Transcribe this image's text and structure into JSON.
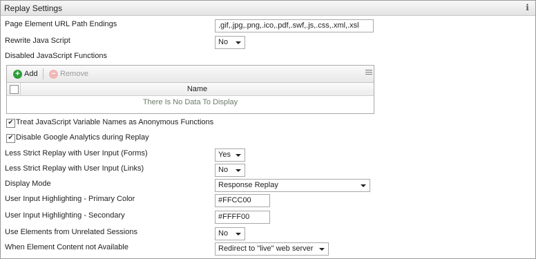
{
  "panel": {
    "title": "Replay Settings",
    "info_icon": "info-icon"
  },
  "fields": {
    "url_endings": {
      "label": "Page Element URL Path Endings",
      "value": ".gif,.jpg,.png,.ico,.pdf,.swf,.js,.css,.xml,.xsl"
    },
    "rewrite_js": {
      "label": "Rewrite Java Script",
      "value": "No"
    },
    "disabled_js": {
      "label": "Disabled JavaScript Functions"
    },
    "less_strict_forms": {
      "label": "Less Strict Replay with User Input (Forms)",
      "value": "Yes"
    },
    "less_strict_links": {
      "label": "Less Strict Replay with User Input (Links)",
      "value": "No"
    },
    "display_mode": {
      "label": "Display Mode",
      "value": "Response Replay"
    },
    "primary_color": {
      "label": "User Input Highlighting - Primary Color",
      "value": "#FFCC00"
    },
    "secondary_color": {
      "label": "User Input Highlighting - Secondary",
      "value": "#FFFF00"
    },
    "unrelated_sessions": {
      "label": "Use Elements from Unrelated Sessions",
      "value": "No"
    },
    "element_unavailable": {
      "label": "When Element Content not Available",
      "value": "Redirect to \"live\" web server"
    }
  },
  "grid": {
    "add_label": "Add",
    "remove_label": "Remove",
    "column_name": "Name",
    "empty_text": "There Is No Data To Display"
  },
  "checkboxes": {
    "anonymous_functions": {
      "label": "Treat JavaScript Variable Names as Anonymous Functions",
      "checked": true
    },
    "disable_ga": {
      "label": "Disable Google Analytics during Replay",
      "checked": true
    }
  }
}
